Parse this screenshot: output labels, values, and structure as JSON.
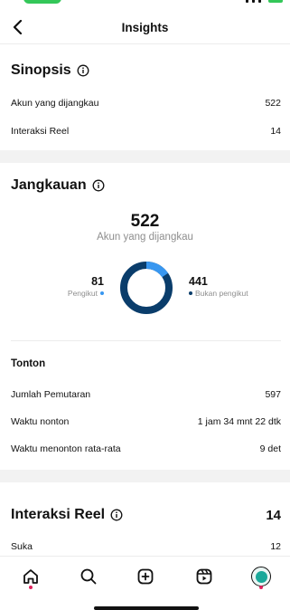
{
  "header": {
    "title": "Insights"
  },
  "sinopsis": {
    "title": "Sinopsis",
    "rows": [
      {
        "label": "Akun yang dijangkau",
        "value": "522"
      },
      {
        "label": "Interaksi Reel",
        "value": "14"
      }
    ]
  },
  "jangkauan": {
    "title": "Jangkauan",
    "total": "522",
    "total_label": "Akun yang dijangkau",
    "followers": {
      "value": "81",
      "label": "Pengikut",
      "color": "#3897f0"
    },
    "non_followers": {
      "value": "441",
      "label": "Bukan pengikut",
      "color": "#0a3d6b"
    },
    "donut_fraction_followers": 0.155
  },
  "tonton": {
    "title": "Tonton",
    "rows": [
      {
        "label": "Jumlah Pemutaran",
        "value": "597"
      },
      {
        "label": "Waktu nonton",
        "value": "1 jam 34 mnt 22 dtk"
      },
      {
        "label": "Waktu menonton rata-rata",
        "value": "9 det"
      }
    ]
  },
  "interaksi": {
    "title": "Interaksi Reel",
    "count": "14",
    "rows": [
      {
        "label": "Suka",
        "value": "12"
      }
    ]
  },
  "nav": {
    "items": [
      "home-icon",
      "search-icon",
      "create-icon",
      "reels-icon",
      "profile-avatar"
    ]
  }
}
